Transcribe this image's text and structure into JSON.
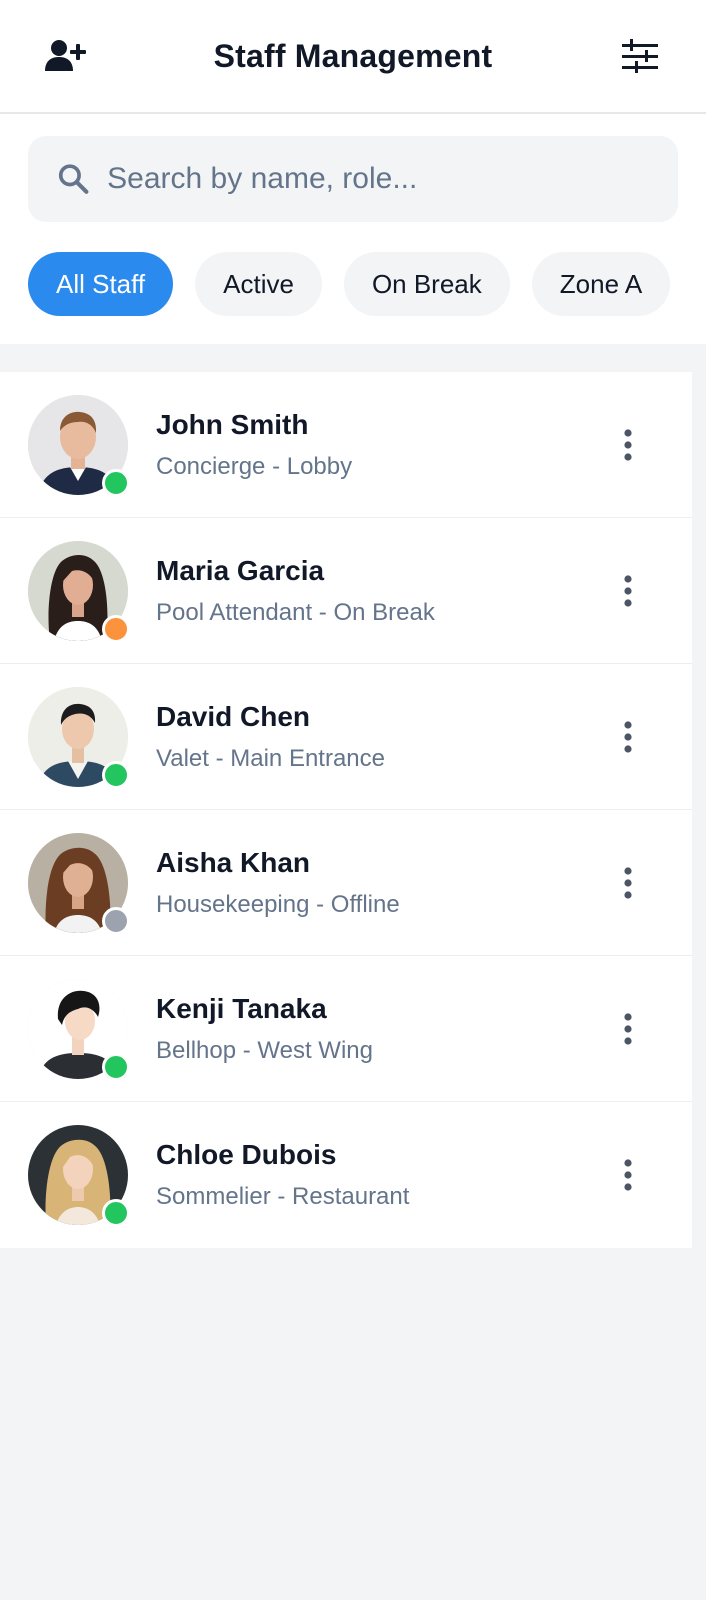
{
  "header": {
    "title": "Staff Management",
    "left_icon": "add-user-icon",
    "right_icon": "filter-sliders-icon"
  },
  "search": {
    "placeholder": "Search by name, role..."
  },
  "filters": [
    {
      "label": "All Staff",
      "active": true
    },
    {
      "label": "Active",
      "active": false
    },
    {
      "label": "On Break",
      "active": false
    },
    {
      "label": "Zone A",
      "active": false
    }
  ],
  "status_colors": {
    "active": "#22C55E",
    "break": "#FB923C",
    "offline": "#9CA3AF"
  },
  "colors": {
    "accent": "#2B8AEE",
    "muted_text": "#64748B"
  },
  "staff": [
    {
      "name": "John Smith",
      "role": "Concierge - Lobby",
      "status": "active"
    },
    {
      "name": "Maria Garcia",
      "role": "Pool Attendant - On Break",
      "status": "break"
    },
    {
      "name": "David Chen",
      "role": "Valet - Main Entrance",
      "status": "active"
    },
    {
      "name": "Aisha Khan",
      "role": "Housekeeping - Offline",
      "status": "offline"
    },
    {
      "name": "Kenji Tanaka",
      "role": "Bellhop - West Wing",
      "status": "active"
    },
    {
      "name": "Chloe Dubois",
      "role": "Sommelier - Restaurant",
      "status": "active"
    }
  ]
}
